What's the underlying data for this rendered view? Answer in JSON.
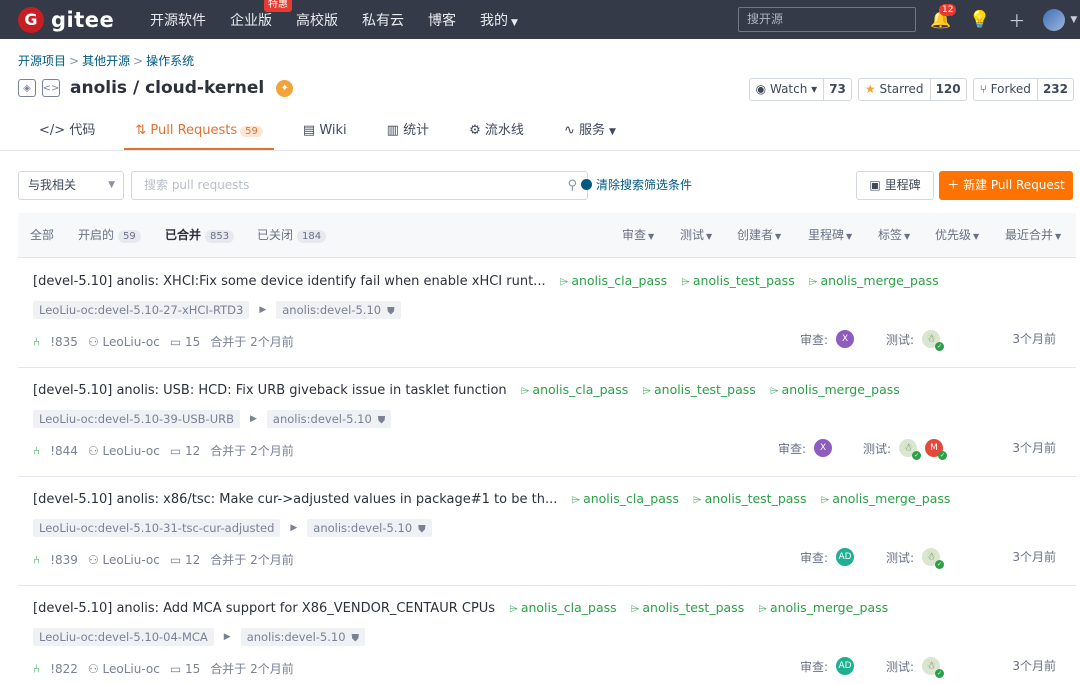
{
  "topbar": {
    "logo_mark": "G",
    "logo_text": "gitee",
    "nav": [
      {
        "label": "开源软件"
      },
      {
        "label": "企业版",
        "badge": "特惠"
      },
      {
        "label": "高校版"
      },
      {
        "label": "私有云"
      },
      {
        "label": "博客"
      },
      {
        "label": "我的"
      }
    ],
    "search_placeholder": "搜开源",
    "notif_count": "12"
  },
  "breadcrumb": [
    "开源项目",
    "其他开源",
    "操作系统"
  ],
  "repo": {
    "name": "anolis / cloud-kernel",
    "watch_label": "Watch",
    "watch_count": "73",
    "star_label": "Starred",
    "star_count": "120",
    "fork_label": "Forked",
    "fork_count": "232"
  },
  "tabs": [
    {
      "label": "代码"
    },
    {
      "label": "Pull Requests",
      "count": "59"
    },
    {
      "label": "Wiki"
    },
    {
      "label": "统计"
    },
    {
      "label": "流水线"
    },
    {
      "label": "服务"
    }
  ],
  "filters": {
    "dropdown": "与我相关",
    "search_placeholder": "搜索 pull requests",
    "clear": "清除搜索筛选条件",
    "milestone": "里程碑",
    "new_pr": "新建 Pull Request"
  },
  "states": [
    {
      "label": "全部"
    },
    {
      "label": "开启的",
      "count": "59"
    },
    {
      "label": "已合并",
      "count": "853"
    },
    {
      "label": "已关闭",
      "count": "184"
    }
  ],
  "sorts": [
    "审查",
    "测试",
    "创建者",
    "里程碑",
    "标签",
    "优先级",
    "最近合并"
  ],
  "common": {
    "reviewer_label": "审查:",
    "tester_label": "测试:",
    "label_cla": "anolis_cla_pass",
    "label_test": "anolis_test_pass",
    "label_merge": "anolis_merge_pass"
  },
  "prs": [
    {
      "title": "[devel-5.10] anolis: XHCI:Fix some device identify fail when enable xHCI runt...",
      "source": "LeoLiu-oc:devel-5.10-27-xHCI-RTD3",
      "target": "anolis:devel-5.10",
      "number": "!835",
      "author": "LeoLiu-oc",
      "comments": "15",
      "merged": "合并于 2个月前",
      "reviewer": "X",
      "time": "3个月前"
    },
    {
      "title": "[devel-5.10] anolis: USB: HCD: Fix URB giveback issue in tasklet function",
      "source": "LeoLiu-oc:devel-5.10-39-USB-URB",
      "target": "anolis:devel-5.10",
      "number": "!844",
      "author": "LeoLiu-oc",
      "comments": "12",
      "merged": "合并于 2个月前",
      "reviewer": "X",
      "tester2": "M",
      "time": "3个月前"
    },
    {
      "title": "[devel-5.10] anolis: x86/tsc: Make cur->adjusted values in package#1 to be th...",
      "source": "LeoLiu-oc:devel-5.10-31-tsc-cur-adjusted",
      "target": "anolis:devel-5.10",
      "number": "!839",
      "author": "LeoLiu-oc",
      "comments": "12",
      "merged": "合并于 2个月前",
      "reviewer": "AD",
      "time": "3个月前"
    },
    {
      "title": "[devel-5.10] anolis: Add MCA support for X86_VENDOR_CENTAUR CPUs",
      "source": "LeoLiu-oc:devel-5.10-04-MCA",
      "target": "anolis:devel-5.10",
      "number": "!822",
      "author": "LeoLiu-oc",
      "comments": "15",
      "merged": "合并于 2个月前",
      "reviewer": "AD",
      "time": "3个月前"
    }
  ]
}
